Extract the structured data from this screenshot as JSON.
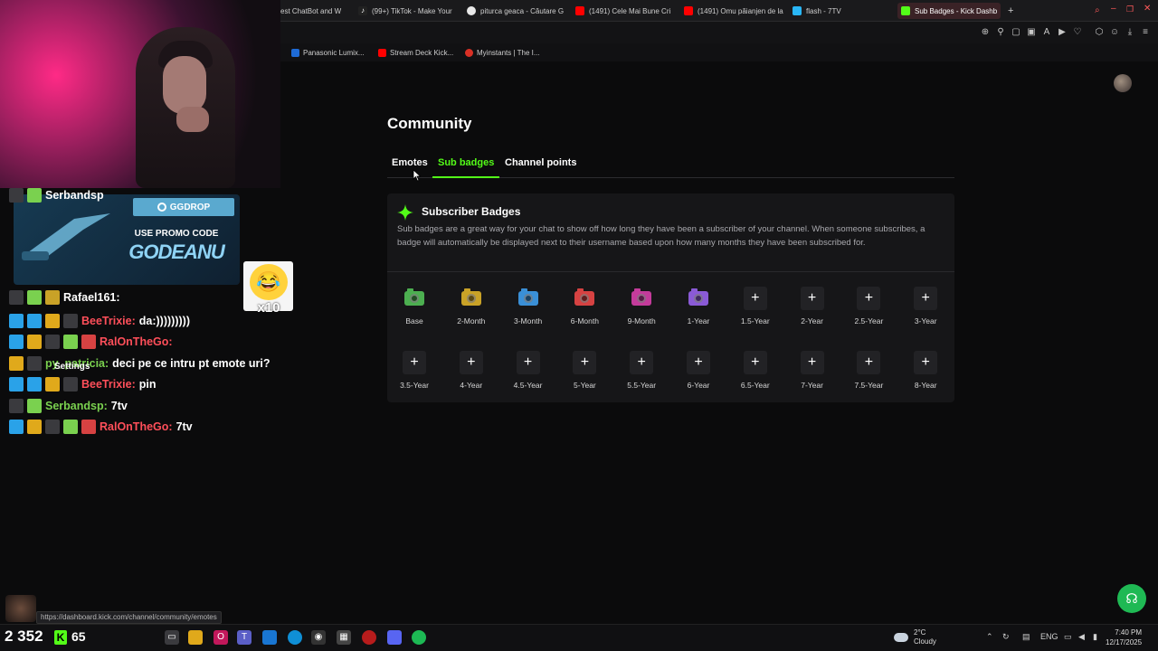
{
  "browser": {
    "tabs": [
      {
        "label": "est ChatBot and W",
        "icon": "chatbot-icon",
        "color": "#2a2a2d"
      },
      {
        "label": "(99+) TikTok - Make Your",
        "icon": "tiktok-icon",
        "color": "#111"
      },
      {
        "label": "piturca geaca - Căutare G",
        "icon": "google-icon",
        "color": "#e8e8e8"
      },
      {
        "label": "(1491) Cele Mai Bune Cri",
        "icon": "youtube-icon",
        "color": "#ff0000"
      },
      {
        "label": "(1491) Omu păianjen de la",
        "icon": "youtube-icon",
        "color": "#ff0000"
      },
      {
        "label": "flash - 7TV",
        "icon": "7tv-icon",
        "color": "#29b6f6"
      },
      {
        "label": "Sub Badges - Kick Dashb",
        "icon": "kick-icon",
        "color": "#53fc18",
        "active": true
      }
    ],
    "new_tab": "+",
    "bookmarks": [
      {
        "label": "Panasonic Lumix...",
        "color": "#1e6bd6"
      },
      {
        "label": "Stream Deck Kick...",
        "color": "#ff0000"
      },
      {
        "label": "Myinstants | The I...",
        "color": "#d93025"
      }
    ]
  },
  "page": {
    "title": "Community",
    "tabs": [
      {
        "label": "Emotes",
        "active": false
      },
      {
        "label": "Sub badges",
        "active": true
      },
      {
        "label": "Channel points",
        "active": false
      }
    ],
    "card": {
      "title": "Subscriber Badges",
      "description": "Sub badges are a great way for your chat to show off how long they have been a subscriber of your channel. When someone subscribes, a badge will automatically be displayed next to their username based upon how many months they have been subscribed for."
    },
    "badges_row1": [
      {
        "label": "Base",
        "color": "#4caf50"
      },
      {
        "label": "2-Month",
        "color": "#c9a227"
      },
      {
        "label": "3-Month",
        "color": "#3a8fd6"
      },
      {
        "label": "6-Month",
        "color": "#d64242"
      },
      {
        "label": "9-Month",
        "color": "#c43b9b"
      },
      {
        "label": "1-Year",
        "color": "#8a5ad6"
      },
      {
        "label": "1.5-Year",
        "plus": "+"
      },
      {
        "label": "2-Year",
        "plus": "+"
      },
      {
        "label": "2.5-Year",
        "plus": "+"
      },
      {
        "label": "3-Year",
        "plus": "+"
      }
    ],
    "badges_row2": [
      {
        "label": "3.5-Year",
        "plus": "+"
      },
      {
        "label": "4-Year",
        "plus": "+"
      },
      {
        "label": "4.5-Year",
        "plus": "+"
      },
      {
        "label": "5-Year",
        "plus": "+"
      },
      {
        "label": "5.5-Year",
        "plus": "+"
      },
      {
        "label": "6-Year",
        "plus": "+"
      },
      {
        "label": "6.5-Year",
        "plus": "+"
      },
      {
        "label": "7-Year",
        "plus": "+"
      },
      {
        "label": "7.5-Year",
        "plus": "+"
      },
      {
        "label": "8-Year",
        "plus": "+"
      }
    ],
    "accent": "#53fc18"
  },
  "overlay": {
    "promo": {
      "brand": "GGDROP",
      "line1": "USE PROMO CODE",
      "line2": "GODEANU"
    },
    "emote_multiplier": "x10",
    "settings_label": "Settings",
    "chat": [
      {
        "user": "Serbandsp",
        "msg": "",
        "user_color": "#ffffff"
      },
      {
        "user": "Rafael161:",
        "msg": "",
        "user_color": "#ffffff"
      },
      {
        "user": "BeeTrixie:",
        "msg": "da:)))))))))",
        "user_color": "#ff4f5a"
      },
      {
        "user": "RalOnTheGo:",
        "msg": "",
        "user_color": "#ff4f5a"
      },
      {
        "user": "py_patricia:",
        "msg": "deci pe ce intru pt emote uri?",
        "user_color": "#7ad14f"
      },
      {
        "user": "BeeTrixie:",
        "msg": "pin",
        "user_color": "#ff4f5a"
      },
      {
        "user": "Serbandsp:",
        "msg": "7tv",
        "user_color": "#7ad14f"
      },
      {
        "user": "RalOnTheGo:",
        "msg": "7tv",
        "user_color": "#ff4f5a"
      }
    ],
    "status_url": "https://dashboard.kick.com/channel/community/emotes",
    "viewer_count": "2 352",
    "kick_count": "65"
  },
  "taskbar": {
    "weather_temp": "2°C",
    "weather_desc": "Cloudy",
    "language": "ENG",
    "time": "7:40 PM",
    "date": "12/17/2025"
  }
}
